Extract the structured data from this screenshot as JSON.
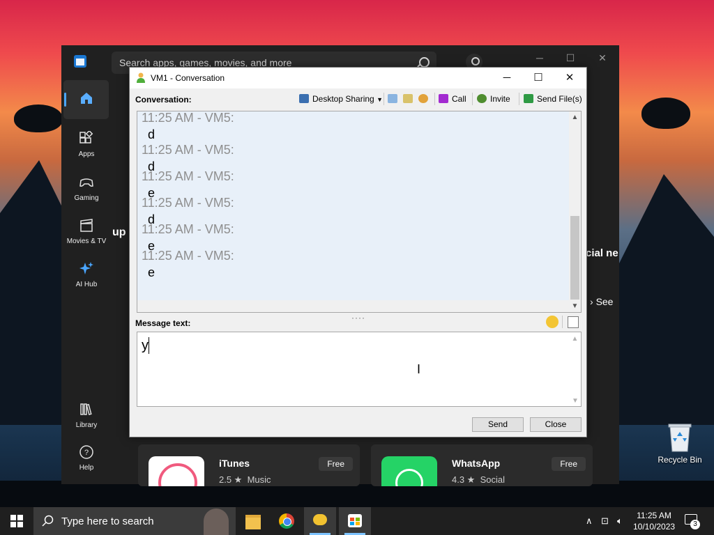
{
  "store": {
    "search_placeholder": "Search apps, games, movies, and more",
    "nav": [
      {
        "label": "Apps",
        "icon": "apps-icon"
      },
      {
        "label": "Gaming",
        "icon": "gamepad-icon"
      },
      {
        "label": "Movies & TV",
        "icon": "clapperboard-icon"
      },
      {
        "label": "AI Hub",
        "icon": "sparkle-icon"
      },
      {
        "label": "Library",
        "icon": "library-icon"
      },
      {
        "label": "Help",
        "icon": "help-icon"
      }
    ],
    "partial_left": "up",
    "partial_right": "cial ne",
    "see_link": "See",
    "cards": [
      {
        "name": "iTunes",
        "rating": "2.5 ★",
        "category": "Music",
        "price": "Free"
      },
      {
        "name": "WhatsApp",
        "rating": "4.3 ★",
        "category": "Social",
        "price": "Free"
      }
    ]
  },
  "conversation": {
    "title": "VM1 - Conversation",
    "conversation_label": "Conversation:",
    "toolbar": {
      "desktop_sharing": "Desktop Sharing",
      "call": "Call",
      "invite": "Invite",
      "send_files": "Send File(s)"
    },
    "messages": [
      {
        "header": "11:25 AM - VM5:",
        "body": "d"
      },
      {
        "header": "11:25 AM - VM5:",
        "body": "d"
      },
      {
        "header": "11:25 AM - VM5:",
        "body": "e"
      },
      {
        "header": "11:25 AM - VM5:",
        "body": "d"
      },
      {
        "header": "11:25 AM - VM5:",
        "body": "e"
      },
      {
        "header": "11:25 AM - VM5:",
        "body": "e"
      }
    ],
    "message_label": "Message text:",
    "message_value": "y",
    "send_label": "Send",
    "close_label": "Close"
  },
  "desktop": {
    "recycle_bin": "Recycle Bin"
  },
  "taskbar": {
    "search_placeholder": "Type here to search",
    "time": "11:25 AM",
    "date": "10/10/2023",
    "notification_count": "3"
  }
}
